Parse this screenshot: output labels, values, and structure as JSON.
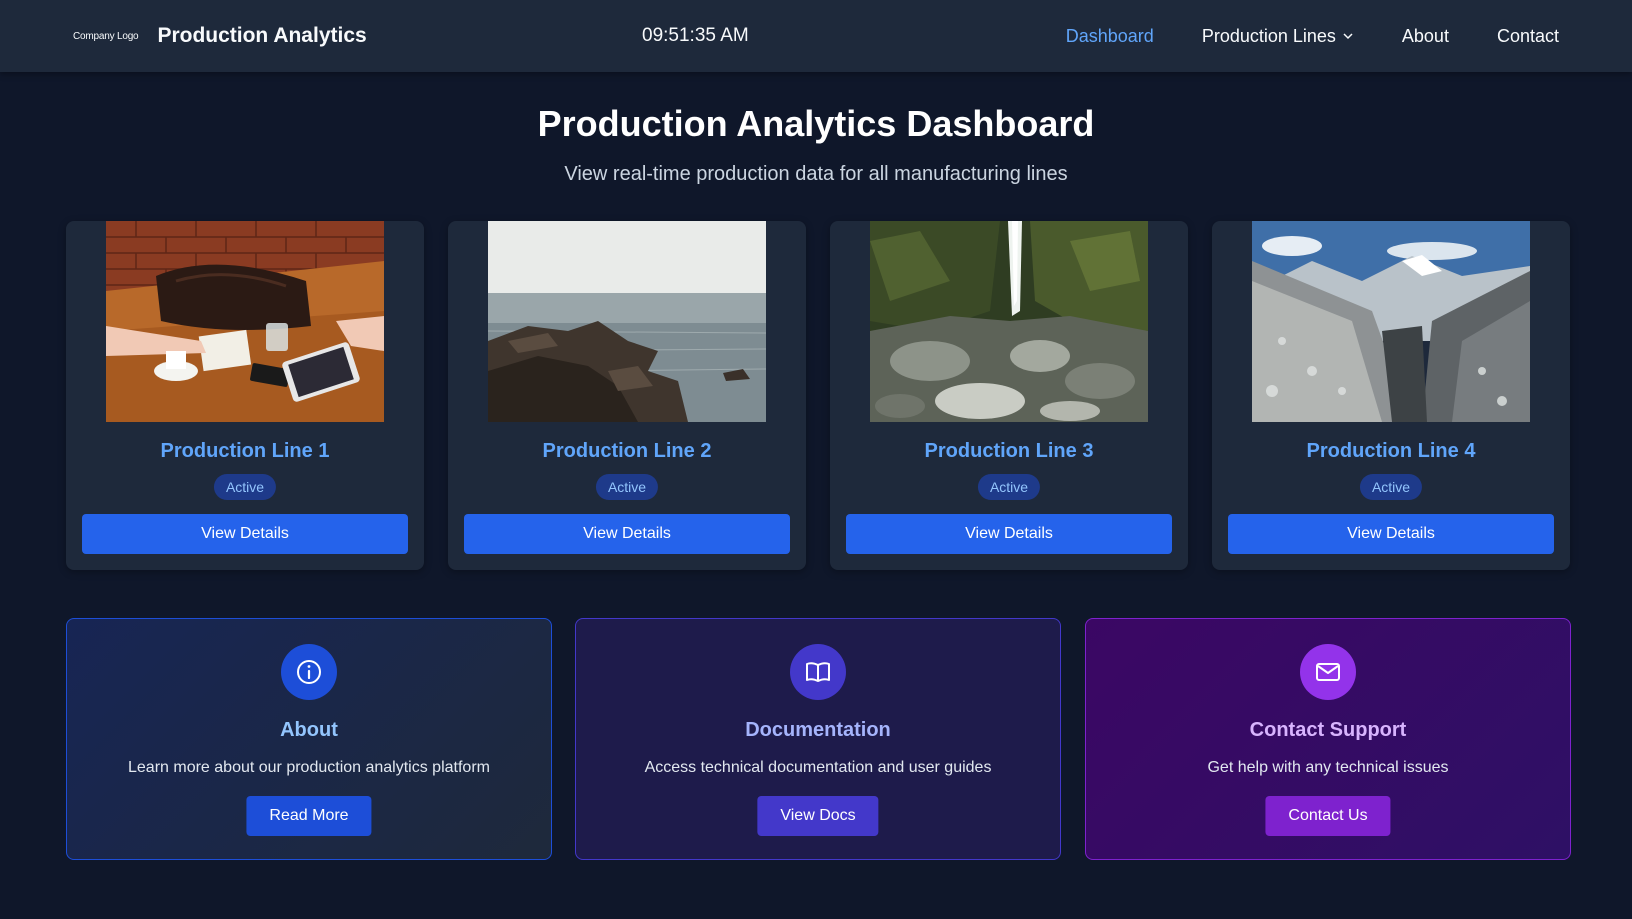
{
  "navbar": {
    "logo_text": "Company Logo",
    "brand_title": "Production Analytics",
    "clock": "09:51:35 AM",
    "links": {
      "dashboard": "Dashboard",
      "production_lines": "Production Lines",
      "about": "About",
      "contact": "Contact"
    }
  },
  "hero": {
    "title": "Production Analytics Dashboard",
    "subtitle": "View real-time production data for all manufacturing lines"
  },
  "production_lines": [
    {
      "title": "Production Line 1",
      "status": "Active",
      "button": "View Details",
      "image": "workspace-table-photo"
    },
    {
      "title": "Production Line 2",
      "status": "Active",
      "button": "View Details",
      "image": "rocky-coast-photo"
    },
    {
      "title": "Production Line 3",
      "status": "Active",
      "button": "View Details",
      "image": "waterfall-gorge-photo"
    },
    {
      "title": "Production Line 4",
      "status": "Active",
      "button": "View Details",
      "image": "snowy-mountains-photo"
    }
  ],
  "info_cards": {
    "about": {
      "title": "About",
      "description": "Learn more about our production analytics platform",
      "button": "Read More",
      "icon": "info-icon"
    },
    "docs": {
      "title": "Documentation",
      "description": "Access technical documentation and user guides",
      "button": "View Docs",
      "icon": "book-icon"
    },
    "support": {
      "title": "Contact Support",
      "description": "Get help with any technical issues",
      "button": "Contact Us",
      "icon": "mail-icon"
    }
  },
  "colors": {
    "background": "#0f172a",
    "navbar": "#1e293b",
    "accent": "#60a5fa",
    "primary_button": "#2563eb"
  }
}
